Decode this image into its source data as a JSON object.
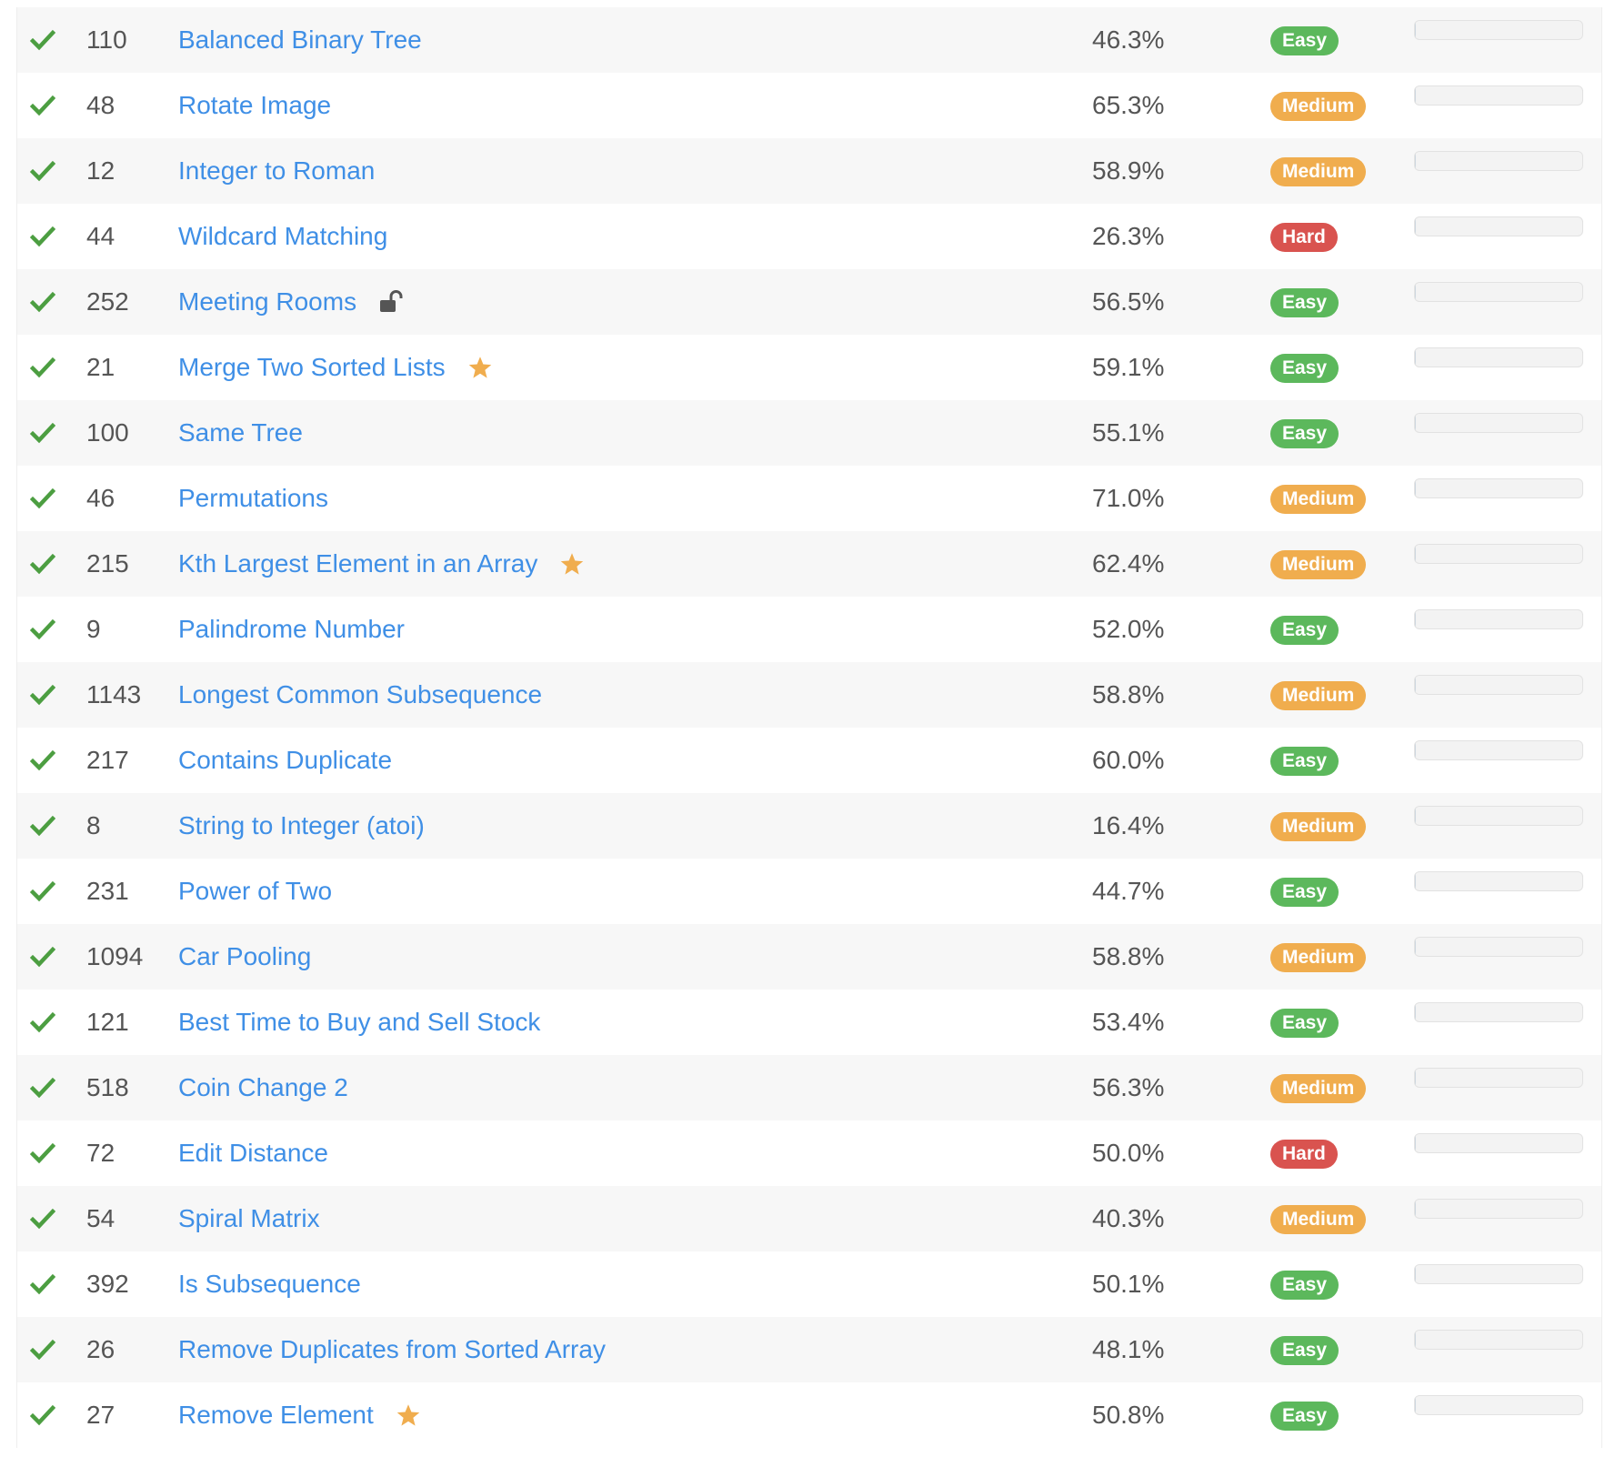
{
  "colors": {
    "link": "#3f8fe6",
    "check": "#4c9e41",
    "star": "#f0ad4e",
    "easy": "#5cb85c",
    "medium": "#f0ad4e",
    "hard": "#d9534f"
  },
  "difficulty_labels": {
    "easy": "Easy",
    "medium": "Medium",
    "hard": "Hard"
  },
  "problems": [
    {
      "id": "110",
      "title": "Balanced Binary Tree",
      "acceptance": "46.3%",
      "difficulty": "Easy",
      "icon": "",
      "solved": true
    },
    {
      "id": "48",
      "title": "Rotate Image",
      "acceptance": "65.3%",
      "difficulty": "Medium",
      "icon": "",
      "solved": true
    },
    {
      "id": "12",
      "title": "Integer to Roman",
      "acceptance": "58.9%",
      "difficulty": "Medium",
      "icon": "",
      "solved": true
    },
    {
      "id": "44",
      "title": "Wildcard Matching",
      "acceptance": "26.3%",
      "difficulty": "Hard",
      "icon": "",
      "solved": true
    },
    {
      "id": "252",
      "title": "Meeting Rooms",
      "acceptance": "56.5%",
      "difficulty": "Easy",
      "icon": "unlock-icon",
      "solved": true
    },
    {
      "id": "21",
      "title": "Merge Two Sorted Lists",
      "acceptance": "59.1%",
      "difficulty": "Easy",
      "icon": "star-icon",
      "solved": true
    },
    {
      "id": "100",
      "title": "Same Tree",
      "acceptance": "55.1%",
      "difficulty": "Easy",
      "icon": "",
      "solved": true
    },
    {
      "id": "46",
      "title": "Permutations",
      "acceptance": "71.0%",
      "difficulty": "Medium",
      "icon": "",
      "solved": true
    },
    {
      "id": "215",
      "title": "Kth Largest Element in an Array",
      "acceptance": "62.4%",
      "difficulty": "Medium",
      "icon": "star-icon",
      "solved": true
    },
    {
      "id": "9",
      "title": "Palindrome Number",
      "acceptance": "52.0%",
      "difficulty": "Easy",
      "icon": "",
      "solved": true
    },
    {
      "id": "1143",
      "title": "Longest Common Subsequence",
      "acceptance": "58.8%",
      "difficulty": "Medium",
      "icon": "",
      "solved": true
    },
    {
      "id": "217",
      "title": "Contains Duplicate",
      "acceptance": "60.0%",
      "difficulty": "Easy",
      "icon": "",
      "solved": true
    },
    {
      "id": "8",
      "title": "String to Integer (atoi)",
      "acceptance": "16.4%",
      "difficulty": "Medium",
      "icon": "",
      "solved": true
    },
    {
      "id": "231",
      "title": "Power of Two",
      "acceptance": "44.7%",
      "difficulty": "Easy",
      "icon": "",
      "solved": true
    },
    {
      "id": "1094",
      "title": "Car Pooling",
      "acceptance": "58.8%",
      "difficulty": "Medium",
      "icon": "",
      "solved": true
    },
    {
      "id": "121",
      "title": "Best Time to Buy and Sell Stock",
      "acceptance": "53.4%",
      "difficulty": "Easy",
      "icon": "",
      "solved": true
    },
    {
      "id": "518",
      "title": "Coin Change 2",
      "acceptance": "56.3%",
      "difficulty": "Medium",
      "icon": "",
      "solved": true
    },
    {
      "id": "72",
      "title": "Edit Distance",
      "acceptance": "50.0%",
      "difficulty": "Hard",
      "icon": "",
      "solved": true
    },
    {
      "id": "54",
      "title": "Spiral Matrix",
      "acceptance": "40.3%",
      "difficulty": "Medium",
      "icon": "",
      "solved": true
    },
    {
      "id": "392",
      "title": "Is Subsequence",
      "acceptance": "50.1%",
      "difficulty": "Easy",
      "icon": "",
      "solved": true
    },
    {
      "id": "26",
      "title": "Remove Duplicates from Sorted Array",
      "acceptance": "48.1%",
      "difficulty": "Easy",
      "icon": "",
      "solved": true
    },
    {
      "id": "27",
      "title": "Remove Element",
      "acceptance": "50.8%",
      "difficulty": "Easy",
      "icon": "star-icon",
      "solved": true
    }
  ]
}
